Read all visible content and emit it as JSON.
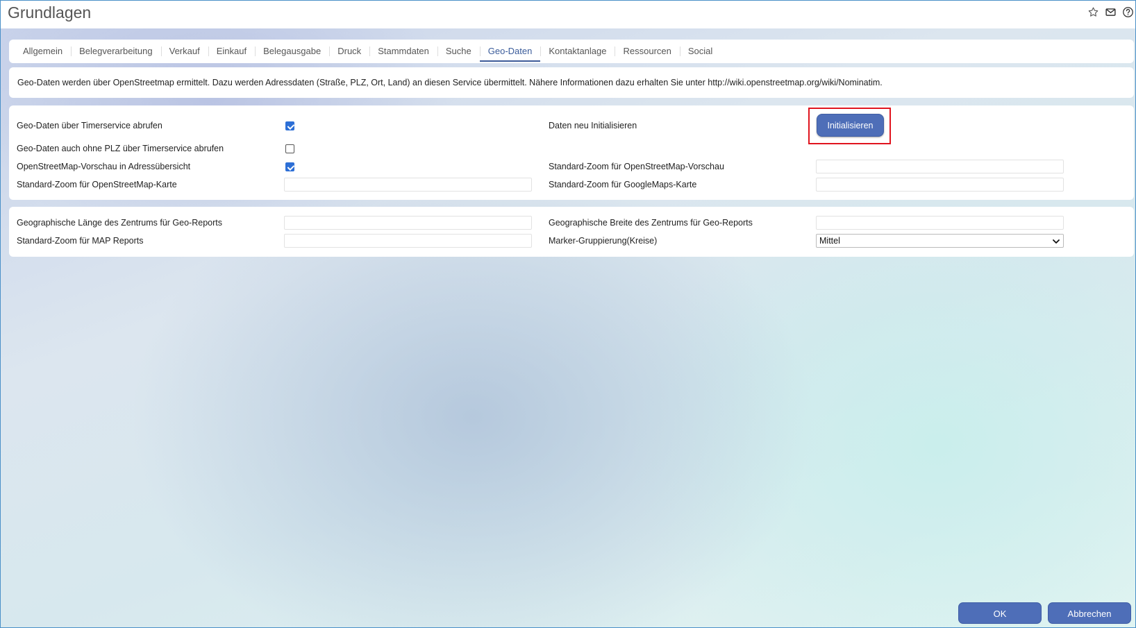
{
  "window": {
    "title": "Grundlagen"
  },
  "tabs": [
    {
      "label": "Allgemein",
      "active": false
    },
    {
      "label": "Belegverarbeitung",
      "active": false
    },
    {
      "label": "Verkauf",
      "active": false
    },
    {
      "label": "Einkauf",
      "active": false
    },
    {
      "label": "Belegausgabe",
      "active": false
    },
    {
      "label": "Druck",
      "active": false
    },
    {
      "label": "Stammdaten",
      "active": false
    },
    {
      "label": "Suche",
      "active": false
    },
    {
      "label": "Geo-Daten",
      "active": true
    },
    {
      "label": "Kontaktanlage",
      "active": false
    },
    {
      "label": "Ressourcen",
      "active": false
    },
    {
      "label": "Social",
      "active": false
    }
  ],
  "info": {
    "text": "Geo-Daten werden über OpenStreetmap ermittelt. Dazu werden Adressdaten (Straße, PLZ, Ort, Land) an diesen Service übermittelt. Nähere Informationen dazu erhalten Sie unter http://wiki.openstreetmap.org/wiki/Nominatim."
  },
  "section1": {
    "timerservice_label": "Geo-Daten über Timerservice abrufen",
    "timerservice_checked": true,
    "ohne_plz_label": "Geo-Daten auch ohne PLZ über Timerservice abrufen",
    "ohne_plz_checked": false,
    "osm_preview_label": "OpenStreetMap-Vorschau in Adressübersicht",
    "osm_preview_checked": true,
    "zoom_osm_karte_label": "Standard-Zoom für OpenStreetMap-Karte",
    "zoom_osm_karte_value": "",
    "reinit_label": "Daten neu Initialisieren",
    "reinit_button": "Initialisieren",
    "zoom_osm_preview_label": "Standard-Zoom für OpenStreetMap-Vorschau",
    "zoom_osm_preview_value": "",
    "zoom_google_label": "Standard-Zoom für GoogleMaps-Karte",
    "zoom_google_value": ""
  },
  "section2": {
    "laenge_label": "Geographische Länge des Zentrums für Geo-Reports",
    "laenge_value": "",
    "zoom_map_reports_label": "Standard-Zoom für MAP Reports",
    "zoom_map_reports_value": "",
    "breite_label": "Geographische Breite des Zentrums für Geo-Reports",
    "breite_value": "",
    "marker_label": "Marker-Gruppierung(Kreise)",
    "marker_value": "Mittel"
  },
  "footer": {
    "ok_label": "OK",
    "cancel_label": "Abbrechen"
  },
  "colors": {
    "accent": "#4e6eb8",
    "highlight": "#e0141e",
    "checkbox": "#2d6fd6"
  }
}
